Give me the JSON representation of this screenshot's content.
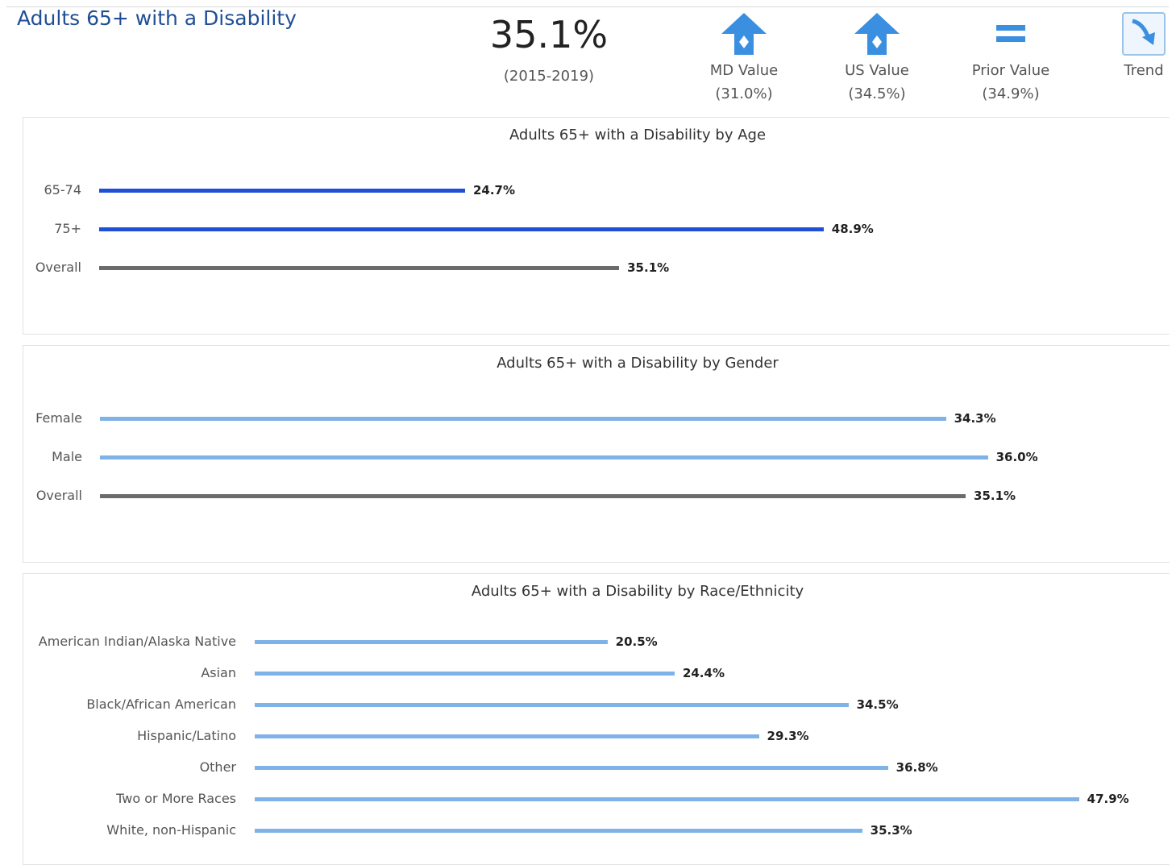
{
  "header": {
    "title": "Adults 65+ with a Disability",
    "value": "35.1%",
    "period": "(2015-2019)",
    "comparisons": [
      {
        "label": "MD Value",
        "value": "(31.0%)",
        "icon": "up-arrow-icon"
      },
      {
        "label": "US Value",
        "value": "(34.5%)",
        "icon": "up-arrow-icon"
      },
      {
        "label": "Prior Value",
        "value": "(34.9%)",
        "icon": "equal-icon"
      },
      {
        "label": "Trend",
        "value": "",
        "icon": "trend-down-icon"
      }
    ]
  },
  "colors": {
    "title": "#1f4e96",
    "age_bar": "#1f4fd6",
    "light_bar": "#7fb2e6",
    "overall_bar": "#6b6b6b",
    "icon": "#3a8fe0"
  },
  "chart_data": [
    {
      "type": "bar",
      "orientation": "horizontal",
      "title": "Adults 65+ with a Disability by Age",
      "categories": [
        "65-74",
        "75+",
        "Overall"
      ],
      "values": [
        24.7,
        48.9,
        35.1
      ],
      "labels": [
        "24.7%",
        "48.9%",
        "35.1%"
      ],
      "bar_colors": [
        "#1f4fd6",
        "#1f4fd6",
        "#6b6b6b"
      ]
    },
    {
      "type": "bar",
      "orientation": "horizontal",
      "title": "Adults 65+ with a Disability by Gender",
      "categories": [
        "Female",
        "Male",
        "Overall"
      ],
      "values": [
        34.3,
        36.0,
        35.1
      ],
      "labels": [
        "34.3%",
        "36.0%",
        "35.1%"
      ],
      "bar_colors": [
        "#7fb2e6",
        "#7fb2e6",
        "#6b6b6b"
      ]
    },
    {
      "type": "bar",
      "orientation": "horizontal",
      "title": "Adults 65+ with a Disability by Race/Ethnicity",
      "categories": [
        "American Indian/Alaska Native",
        "Asian",
        "Black/African American",
        "Hispanic/Latino",
        "Other",
        "Two or More Races",
        "White, non-Hispanic"
      ],
      "values": [
        20.5,
        24.4,
        34.5,
        29.3,
        36.8,
        47.9,
        35.3
      ],
      "labels": [
        "20.5%",
        "24.4%",
        "34.5%",
        "29.3%",
        "36.8%",
        "47.9%",
        "35.3%"
      ],
      "bar_colors": [
        "#7fb2e6",
        "#7fb2e6",
        "#7fb2e6",
        "#7fb2e6",
        "#7fb2e6",
        "#7fb2e6",
        "#7fb2e6"
      ]
    }
  ]
}
